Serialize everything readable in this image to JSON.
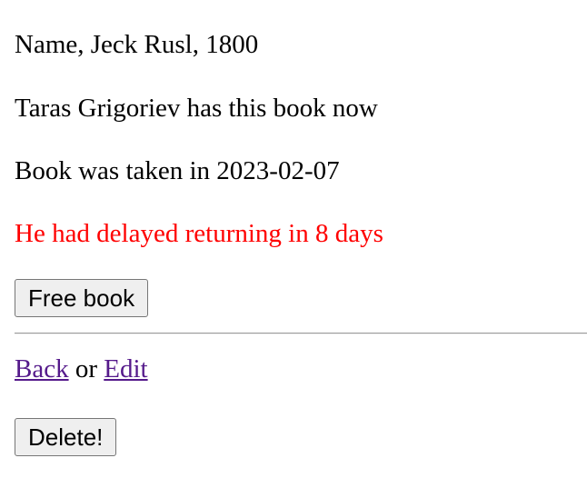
{
  "book": {
    "info": "Name, Jeck Rusl, 1800",
    "holder_text": "Taras Grigoriev has this book now",
    "taken_text": "Book was taken in 2023-02-07",
    "delay_text": "He had delayed returning in 8 days"
  },
  "actions": {
    "free_label": "Free book",
    "back_label": "Back",
    "or_text": " or ",
    "edit_label": "Edit",
    "delete_label": "Delete!"
  },
  "colors": {
    "warning": "#ff0000",
    "visited_link": "#551a8b"
  }
}
